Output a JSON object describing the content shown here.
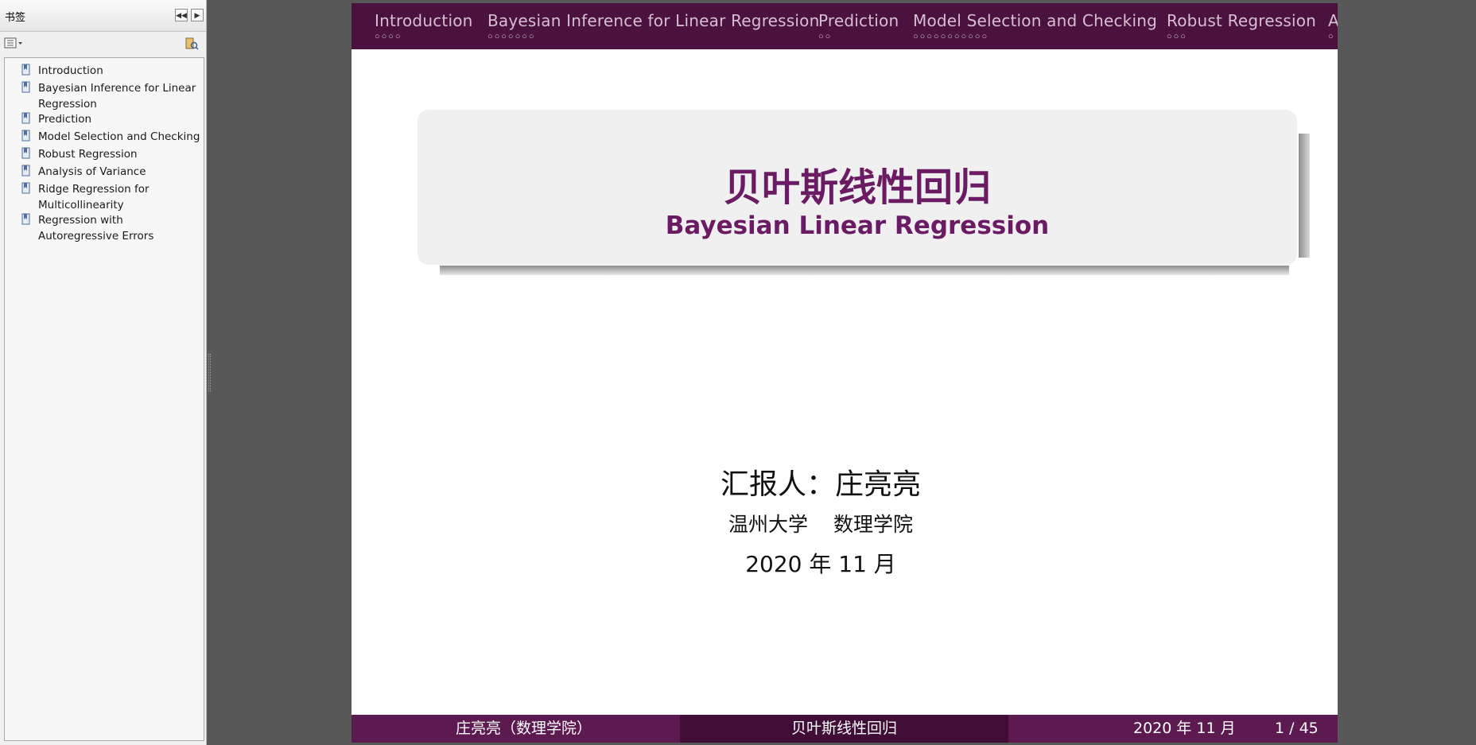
{
  "sidebar": {
    "title": "书签",
    "collapse_icon": "double-chevron-left-icon",
    "expand_icon": "chevron-right-icon",
    "options_icon": "list-options-icon",
    "find_icon": "find-bookmark-icon",
    "items": [
      {
        "label": "Introduction"
      },
      {
        "label": "Bayesian Inference for Linear Regression"
      },
      {
        "label": "Prediction"
      },
      {
        "label": "Model Selection and Checking"
      },
      {
        "label": "Robust Regression"
      },
      {
        "label": "Analysis of Variance"
      },
      {
        "label": "Ridge Regression for Multicollinearity"
      },
      {
        "label": "Regression with Autoregressive Errors"
      }
    ]
  },
  "slide": {
    "nav": [
      {
        "title": "Introduction",
        "dots": "○○○○"
      },
      {
        "title": "Bayesian Inference for Linear Regression",
        "dots": "○○○○○○○"
      },
      {
        "title": "Prediction",
        "dots": "○○"
      },
      {
        "title": "Model Selection and Checking",
        "dots": "○○○○○○○○○○○"
      },
      {
        "title": "Robust Regression",
        "dots": "○○○"
      },
      {
        "title": "A",
        "dots": "○"
      }
    ],
    "title_zh": "贝叶斯线性回归",
    "title_en": "Bayesian Linear Regression",
    "presenter": "汇报人：庄亮亮",
    "university": "温州大学",
    "school": "数理学院",
    "date": "2020 年 11 月",
    "footer": {
      "author": "庄亮亮（数理学院）",
      "short_title": "贝叶斯线性回归",
      "date": "2020 年 11 月",
      "page": "1 / 45"
    }
  },
  "colors": {
    "nav_bg": "#4b1240",
    "title_color": "#6a1b63",
    "footer_light": "#5c1a51",
    "footer_dark": "#3f0d36",
    "viewer_bg": "#585858"
  }
}
